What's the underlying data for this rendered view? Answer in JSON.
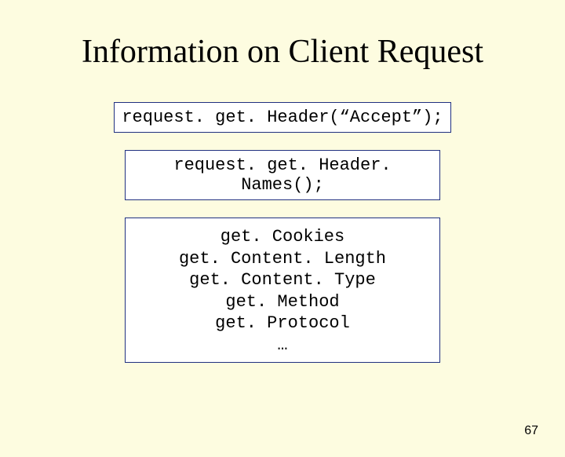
{
  "title": "Information on Client Request",
  "code1": "request. get. Header(“Accept”);",
  "code2": "request. get. Header. Names();",
  "list": {
    "l1": "get. Cookies",
    "l2": "get. Content. Length",
    "l3": "get. Content. Type",
    "l4": "get. Method",
    "l5": "get. Protocol",
    "l6": "…"
  },
  "page": "67"
}
